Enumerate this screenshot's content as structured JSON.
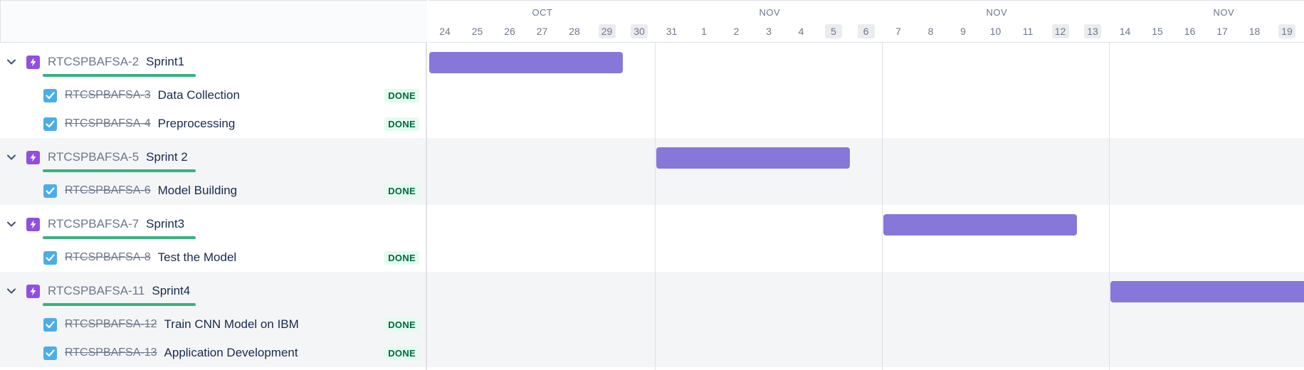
{
  "colors": {
    "epic_bar": "#8777d9",
    "progress": "#36b37e",
    "done_text": "#006644",
    "done_bg": "#e3fcef",
    "epic_icon": "#904ee2",
    "task_icon": "#4bade8"
  },
  "timeline": {
    "months": [
      "OCT",
      "NOV",
      "NOV",
      "NOV"
    ],
    "days": [
      {
        "label": "24",
        "weekend": false
      },
      {
        "label": "25",
        "weekend": false
      },
      {
        "label": "26",
        "weekend": false
      },
      {
        "label": "27",
        "weekend": false
      },
      {
        "label": "28",
        "weekend": false
      },
      {
        "label": "29",
        "weekend": true
      },
      {
        "label": "30",
        "weekend": true
      },
      {
        "label": "31",
        "weekend": false
      },
      {
        "label": "1",
        "weekend": false
      },
      {
        "label": "2",
        "weekend": false
      },
      {
        "label": "3",
        "weekend": false
      },
      {
        "label": "4",
        "weekend": false
      },
      {
        "label": "5",
        "weekend": true
      },
      {
        "label": "6",
        "weekend": true
      },
      {
        "label": "7",
        "weekend": false
      },
      {
        "label": "8",
        "weekend": false
      },
      {
        "label": "9",
        "weekend": false
      },
      {
        "label": "10",
        "weekend": false
      },
      {
        "label": "11",
        "weekend": false
      },
      {
        "label": "12",
        "weekend": true
      },
      {
        "label": "13",
        "weekend": true
      },
      {
        "label": "14",
        "weekend": false
      },
      {
        "label": "15",
        "weekend": false
      },
      {
        "label": "16",
        "weekend": false
      },
      {
        "label": "17",
        "weekend": false
      },
      {
        "label": "18",
        "weekend": false
      },
      {
        "label": "19",
        "weekend": true
      }
    ]
  },
  "epics": [
    {
      "key": "RTCSPBAFSA-2",
      "name": "Sprint1",
      "expand_icon": "chevron-down-icon",
      "tasks": [
        {
          "key": "RTCSPBAFSA-3",
          "name": "Data Collection",
          "status": "DONE"
        },
        {
          "key": "RTCSPBAFSA-4",
          "name": "Preprocessing",
          "status": "DONE"
        }
      ]
    },
    {
      "key": "RTCSPBAFSA-5",
      "name": "Sprint 2",
      "expand_icon": "chevron-down-icon",
      "tasks": [
        {
          "key": "RTCSPBAFSA-6",
          "name": "Model Building",
          "status": "DONE"
        }
      ]
    },
    {
      "key": "RTCSPBAFSA-7",
      "name": "Sprint3",
      "expand_icon": "chevron-down-icon",
      "tasks": [
        {
          "key": "RTCSPBAFSA-8",
          "name": "Test the Model",
          "status": "DONE"
        }
      ]
    },
    {
      "key": "RTCSPBAFSA-11",
      "name": "Sprint4",
      "expand_icon": "chevron-down-icon",
      "tasks": [
        {
          "key": "RTCSPBAFSA-12",
          "name": "Train CNN Model on IBM",
          "status": "DONE"
        },
        {
          "key": "RTCSPBAFSA-13",
          "name": "Application Development",
          "status": "DONE"
        }
      ]
    }
  ]
}
